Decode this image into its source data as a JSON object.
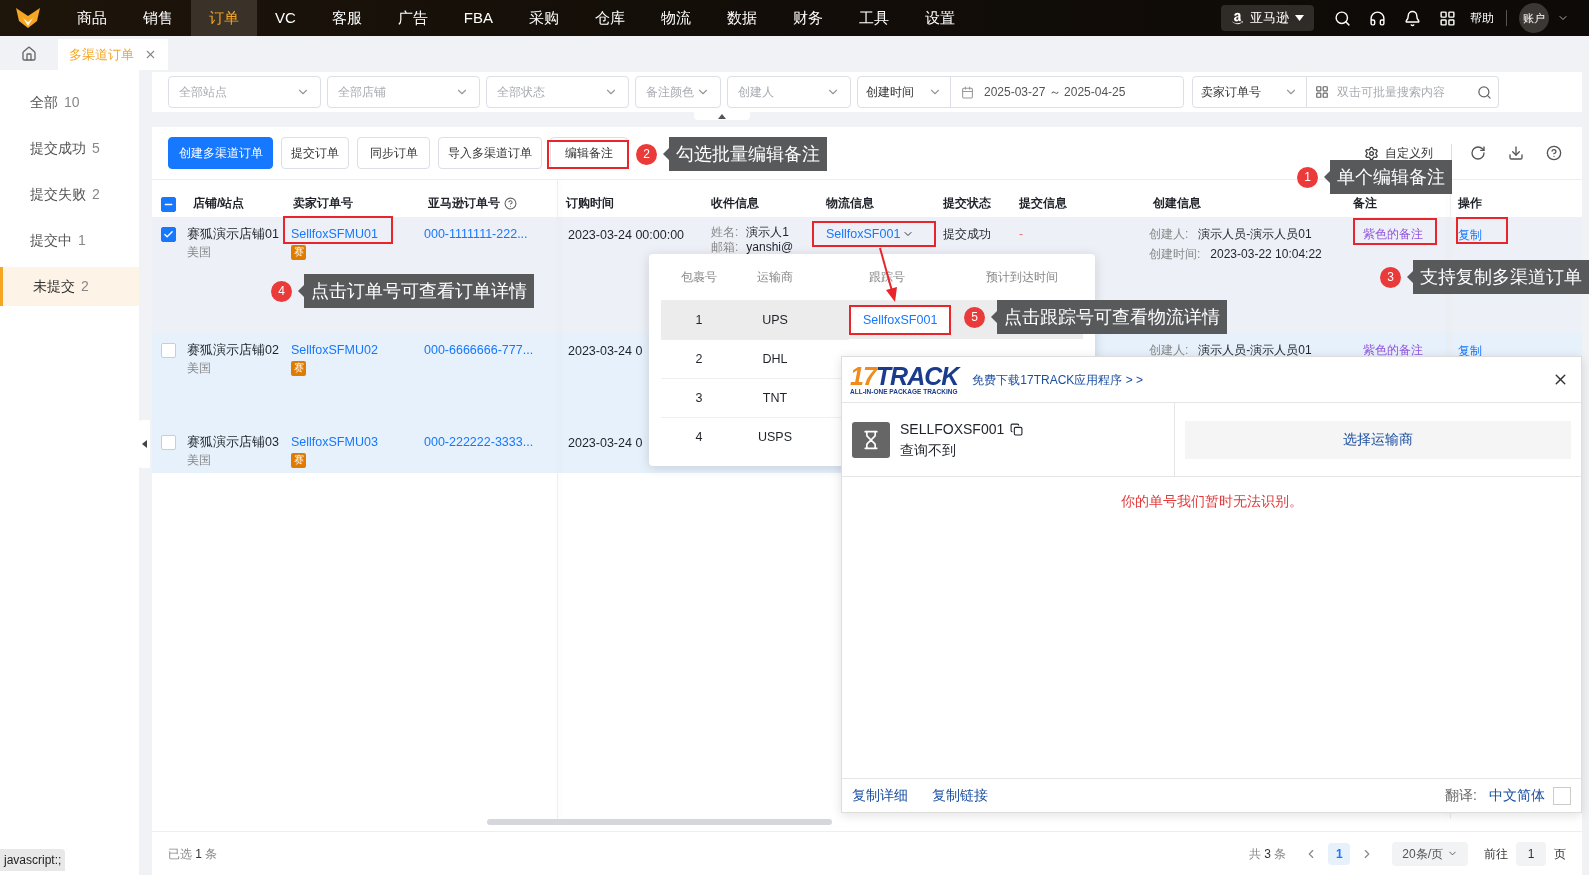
{
  "nav": {
    "items": [
      {
        "label": "商品",
        "selected": false
      },
      {
        "label": "销售",
        "selected": false
      },
      {
        "label": "订单",
        "selected": true
      },
      {
        "label": "VC",
        "selected": false
      },
      {
        "label": "客服",
        "selected": false
      },
      {
        "label": "广告",
        "selected": false
      },
      {
        "label": "FBA",
        "selected": false
      },
      {
        "label": "采购",
        "selected": false
      },
      {
        "label": "仓库",
        "selected": false
      },
      {
        "label": "物流",
        "selected": false
      },
      {
        "label": "数据",
        "selected": false
      },
      {
        "label": "财务",
        "selected": false
      },
      {
        "label": "工具",
        "selected": false
      },
      {
        "label": "设置",
        "selected": false
      }
    ],
    "platform": "亚马逊",
    "help": "帮助",
    "account": "账户"
  },
  "tabs": [
    {
      "label": "多渠道订单",
      "selected": true
    }
  ],
  "sidebar": [
    {
      "label": "全部",
      "count": "10",
      "selected": false
    },
    {
      "label": "提交成功",
      "count": "5",
      "selected": false
    },
    {
      "label": "提交失败",
      "count": "2",
      "selected": false
    },
    {
      "label": "提交中",
      "count": "1",
      "selected": false
    },
    {
      "label": "未提交",
      "count": "2",
      "selected": true
    }
  ],
  "filters": {
    "selects": [
      {
        "placeholder": "全部站点"
      },
      {
        "placeholder": "全部店铺"
      },
      {
        "placeholder": "全部状态"
      },
      {
        "placeholder": "备注颜色"
      },
      {
        "placeholder": "创建人"
      }
    ],
    "date": {
      "type": "创建时间",
      "range": "2025-03-27 ～ 2025-04-25"
    },
    "search": {
      "type": "卖家订单号",
      "placeholder": "双击可批量搜索内容"
    }
  },
  "toolbar": {
    "buttons": [
      {
        "label": "创建多渠道订单",
        "kind": "primary"
      },
      {
        "label": "提交订单",
        "kind": "default"
      },
      {
        "label": "同步订单",
        "kind": "default"
      },
      {
        "label": "导入多渠道订单",
        "kind": "default"
      },
      {
        "label": "编辑备注",
        "kind": "default"
      }
    ],
    "custom_columns": "自定义列"
  },
  "table": {
    "indeterminate": true,
    "columns": [
      "店铺/站点",
      "卖家订单号",
      "亚马逊订单号",
      "订购时间",
      "收件信息",
      "物流信息",
      "提交状态",
      "提交信息",
      "创建信息",
      "备注",
      "操作"
    ],
    "rows": [
      {
        "checked": true,
        "store": "赛狐演示店铺01",
        "site": "美国",
        "seller_order": "SellfoxSFMU01",
        "badge": "赛",
        "amazon_order": "000-1111111-222...",
        "order_time": "2023-03-24 00:00:00",
        "receiver": [
          {
            "label": "姓名:",
            "value": "演示人1"
          },
          {
            "label": "邮箱:",
            "value": "yanshi@"
          }
        ],
        "logistics": "SellfoxSF001",
        "status": "提交成功",
        "info": "-",
        "created": [
          {
            "label": "创建人:",
            "value": "演示人员-演示人员01"
          },
          {
            "label": "创建时间:",
            "value": "2023-03-22 10:04:22"
          }
        ],
        "note": "紫色的备注",
        "action": "复制"
      },
      {
        "checked": false,
        "store": "赛狐演示店铺02",
        "site": "美国",
        "seller_order": "SellfoxSFMU02",
        "badge": "赛",
        "amazon_order": "000-6666666-777...",
        "order_time": "2023-03-24 0",
        "created": [
          {
            "label": "创建人:",
            "value": "演示人员-演示人员01"
          }
        ],
        "note": "紫色的备注",
        "action": "复制"
      },
      {
        "checked": false,
        "store": "赛狐演示店铺03",
        "site": "美国",
        "seller_order": "SellfoxSFMU03",
        "badge": "赛",
        "amazon_order": "000-222222-3333...",
        "order_time": "2023-03-24 0"
      }
    ]
  },
  "tracking_popup": {
    "columns": [
      "包裹号",
      "运输商",
      "跟踪号",
      "预计到达时间"
    ],
    "rows": [
      {
        "no": "1",
        "carrier": "UPS",
        "tracking": "SellfoxSF001",
        "selected": true
      },
      {
        "no": "2",
        "carrier": "DHL",
        "selected": false
      },
      {
        "no": "3",
        "carrier": "TNT",
        "selected": false
      },
      {
        "no": "4",
        "carrier": "USPS",
        "selected": false
      }
    ]
  },
  "track_panel": {
    "brand": [
      "17",
      "TRACK"
    ],
    "tagline": "ALL-IN-ONE PACKAGE TRACKING",
    "download_link": "免费下载17TRACK应用程序 > >",
    "number": "SELLFOXSF001",
    "status": "查询不到",
    "carrier_button": "选择运输商",
    "message": "你的单号我们暂时无法识别。",
    "actions": [
      "复制详细",
      "复制链接"
    ],
    "translate_label": "翻译:",
    "language": "中文简体",
    "translate_checked": false
  },
  "callouts": [
    {
      "number": "1",
      "text": "单个编辑备注"
    },
    {
      "number": "2",
      "text": "勾选批量编辑备注"
    },
    {
      "number": "3",
      "text": "支持复制多渠道订单"
    },
    {
      "number": "4",
      "text": "点击订单号可查看订单详情"
    },
    {
      "number": "5",
      "text": "点击跟踪号可查看物流详情"
    }
  ],
  "footer": {
    "selected_label": "已选",
    "selected_count": "1",
    "selected_unit": "条",
    "total_label": "共",
    "total_count": "3",
    "total_unit": "条",
    "pages": [
      {
        "label": "1",
        "selected": true
      }
    ],
    "page_size": "20条/页",
    "goto_label": "前往",
    "goto_value": "1",
    "goto_unit": "页"
  },
  "status_tip": "javascript:;"
}
